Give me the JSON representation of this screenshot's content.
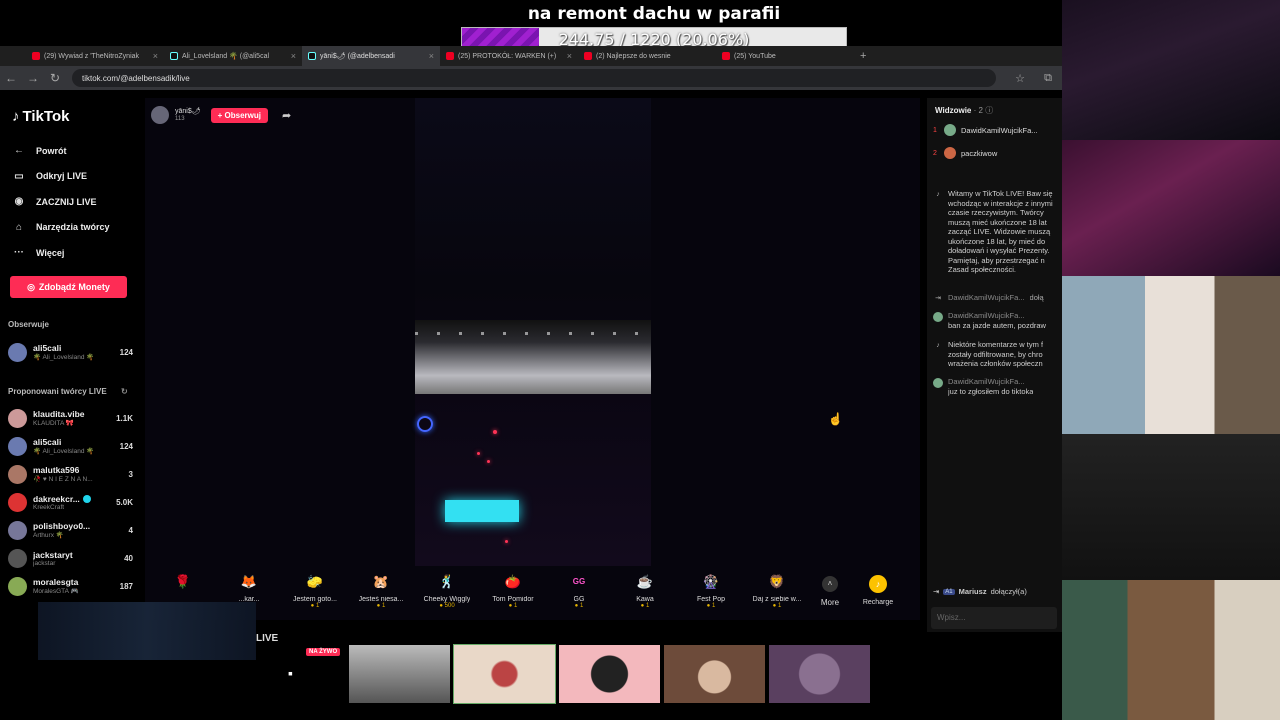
{
  "donation": {
    "title": "na remont dachu w parafii",
    "progress_text": "244.75 / 1220 (20.06%)",
    "progress": 0.2006
  },
  "browser": {
    "tabs": [
      {
        "label": "(29) Wywiad z 'TheNitroZyniak"
      },
      {
        "label": "Ali_Lovelsland 🌴 (@ali5cal"
      },
      {
        "label": "yāni$🌶 (@adelbensadi"
      },
      {
        "label": "(25) PROTOKÓŁ: WARKEN (+)"
      },
      {
        "label": "(2) Najlepsze do wesnie"
      },
      {
        "label": "(25) YouTube"
      }
    ],
    "url": "tiktok.com/@adelbensadik/live"
  },
  "sidebar": {
    "logo": "TikTok",
    "menu": [
      {
        "label": "Powrót",
        "icon": "←"
      },
      {
        "label": "Odkryj LIVE",
        "icon": "▭"
      },
      {
        "label": "ZACZNIJ LIVE",
        "icon": "◉"
      },
      {
        "label": "Narzędzia twórcy",
        "icon": "⌂"
      },
      {
        "label": "Więcej",
        "icon": "···"
      }
    ],
    "coins_button": "Zdobądź Monety",
    "following_title": "Obserwuje",
    "following": [
      {
        "name": "ali5cali",
        "sub": "🌴 Ali_Lovelsland 🌴",
        "count": "124",
        "color": "#6a7ab0"
      }
    ],
    "suggested_title": "Proponowani twórcy LIVE",
    "suggested": [
      {
        "name": "klaudita.vibe",
        "sub": "KLAUDITA 🎀",
        "count": "1.1K",
        "color": "#c99"
      },
      {
        "name": "ali5cali",
        "sub": "🌴 Ali_Lovelsland 🌴",
        "count": "124",
        "color": "#6a7ab0"
      },
      {
        "name": "malutka596",
        "sub": "🥀 ♥ N I E Z N A N...",
        "count": "3",
        "color": "#a76"
      },
      {
        "name": "dakreekcr...",
        "sub": "KreekCraft",
        "count": "5.0K",
        "color": "#d33"
      },
      {
        "name": "polishboyo0...",
        "sub": "Arthurx 🌴",
        "count": "4",
        "color": "#779"
      },
      {
        "name": "jackstaryt",
        "sub": "jackstar",
        "count": "40",
        "color": "#555"
      },
      {
        "name": "moralesgta",
        "sub": "MoralesGTA 🎮",
        "count": "187",
        "color": "#8a5"
      }
    ]
  },
  "stream": {
    "streamer": "yāni$🌶",
    "viewers_small": "113",
    "follow_label": "+ Obserwuj"
  },
  "gifts": [
    {
      "icon": "🌹",
      "name": "",
      "price": ""
    },
    {
      "icon": "🦊",
      "name": "...kar...",
      "price": ""
    },
    {
      "icon": "🧽",
      "name": "Jestem goto...",
      "price": "1"
    },
    {
      "icon": "🐹",
      "name": "Jesteś niesa...",
      "price": "1"
    },
    {
      "icon": "🕺",
      "name": "Cheeky Wiggly",
      "price": "500"
    },
    {
      "icon": "🍅",
      "name": "Tom Pomidor",
      "price": "1"
    },
    {
      "icon": "GG",
      "name": "GG",
      "price": "1"
    },
    {
      "icon": "☕",
      "name": "Kawa",
      "price": "1"
    },
    {
      "icon": "🎡",
      "name": "Fest Pop",
      "price": "1"
    },
    {
      "icon": "🦁",
      "name": "Daj z siebie w...",
      "price": "1"
    }
  ],
  "gift_more": "More",
  "recharge": "Recharge",
  "chat": {
    "viewers_title": "Widzowie",
    "viewers_count": "· 2",
    "top_viewers": [
      {
        "rank": "1",
        "name": "DawidKamilWujcikFa...",
        "color": "#7a8"
      },
      {
        "rank": "2",
        "name": "paczkiwow",
        "color": "#c64"
      }
    ],
    "messages": [
      {
        "name": "",
        "text": "Witamy w TikTok LIVE! Baw się\nwchodząc w interakcje z innymi\nczasie rzeczywistym. Twórcy\nmuszą mieć ukończone 18 lat\nzacząć LIVE. Widzowie muszą\nukończone 18 lat, by mieć do\ndoładowań i wysyłać Prezenty.\nPamiętaj, aby przestrzegać n\nZasad społeczności."
      },
      {
        "name": "DawidKamilWujcikFa...",
        "text": "dołą"
      },
      {
        "name": "DawidKamilWujcikFa...",
        "text": "ban za jazde autem, pozdraw"
      },
      {
        "name": "",
        "text": "Niektóre komentarze w tym f\nzostały odfiltrowane, by chro\nwrażenia członków społeczn"
      },
      {
        "name": "DawidKamilWujcikFa...",
        "text": "juz to zgłosiłem do tiktoka"
      }
    ],
    "joined_level": "A1",
    "joined_name": "Mariusz",
    "joined_text": "dołączył(a)",
    "input_placeholder": "Wpisz..."
  },
  "bottom": {
    "live_label": "LIVE",
    "badge": "NA ŻYWO"
  }
}
